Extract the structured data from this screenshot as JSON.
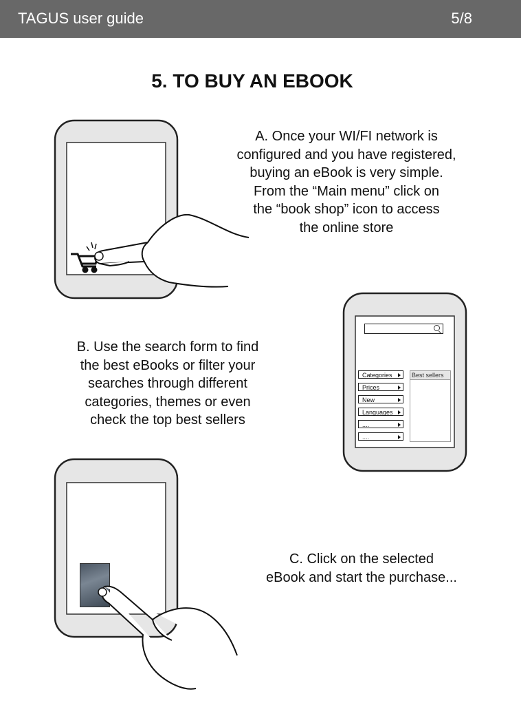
{
  "header": {
    "title": "TAGUS user guide",
    "page": "5/8"
  },
  "heading": "5. TO BUY AN EBOOK",
  "step_a": {
    "lines": [
      "A. Once your WI/FI network is",
      "configured and you have registered,",
      "buying an eBook is very simple.",
      "From the “Main menu” click on",
      "the “book shop” icon to access",
      "the online store"
    ]
  },
  "step_b": {
    "lines": [
      "B. Use the search form to find",
      "the best eBooks or filter your",
      "searches through different",
      "categories, themes or even",
      "check the top best sellers"
    ],
    "device": {
      "menu": [
        "Categories",
        "Prices",
        "New",
        "Languages",
        "....",
        "...."
      ],
      "bestsellers_label": "Best sellers"
    }
  },
  "step_c": {
    "lines": [
      "C. Click on the selected",
      "eBook and start the purchase..."
    ]
  },
  "icons": [
    "shopping-cart-icon",
    "hand-pointer-icon",
    "search-icon",
    "chevron-right-icon"
  ]
}
